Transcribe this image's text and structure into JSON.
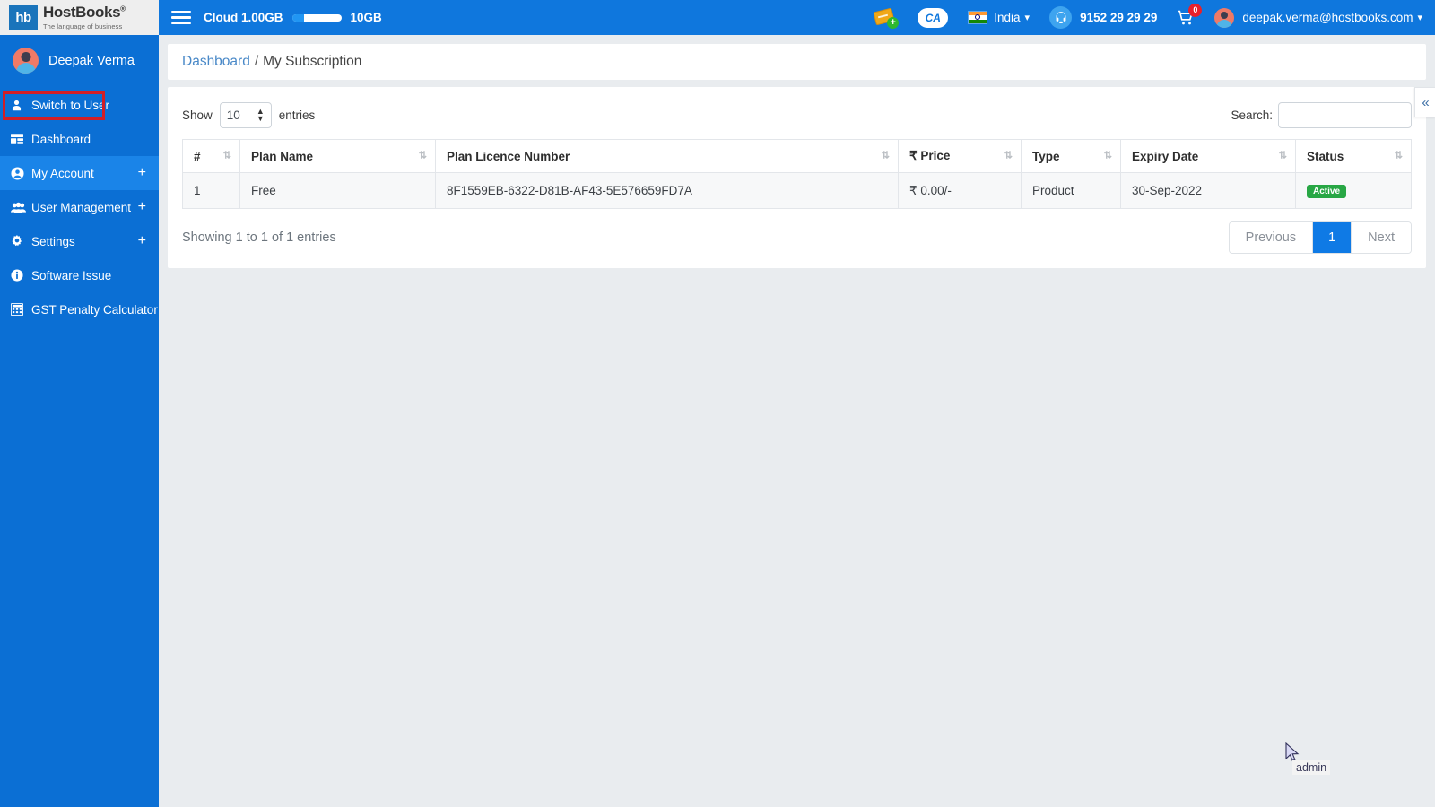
{
  "brand": {
    "logo_mark": "hb",
    "logo_title": "HostBooks",
    "logo_reg": "®",
    "logo_tagline": "The language of business"
  },
  "topbar": {
    "menu_icon": "hamburger-icon",
    "cloud_used_label": "Cloud 1.00GB",
    "cloud_total_label": "10GB",
    "cloud_fill_percent": 25,
    "raise_ticket_icon": "ticket-plus-icon",
    "ca_label": "CA",
    "country": "India",
    "country_flag_icon": "india-flag-icon",
    "support_icon": "headset-icon",
    "phone": "9152 29 29 29",
    "cart_icon": "cart-icon",
    "cart_badge": "0",
    "user_email": "deepak.verma@hostbooks.com",
    "caret_glyph": "⌄"
  },
  "sidebar": {
    "profile_name": "Deepak Verma",
    "profile_avatar": "user-avatar",
    "items": [
      {
        "label": "Switch to User",
        "icon": "person-icon",
        "has_plus": false,
        "active": false,
        "highlighted": true
      },
      {
        "label": "Dashboard",
        "icon": "dashboard-icon",
        "has_plus": false,
        "active": false,
        "highlighted": false
      },
      {
        "label": "My Account",
        "icon": "account-circle-icon",
        "has_plus": true,
        "active": true,
        "highlighted": false
      },
      {
        "label": "User Management",
        "icon": "users-icon",
        "has_plus": true,
        "active": false,
        "highlighted": false
      },
      {
        "label": "Settings",
        "icon": "gear-icon",
        "has_plus": true,
        "active": false,
        "highlighted": false
      },
      {
        "label": "Software Issue",
        "icon": "info-icon",
        "has_plus": false,
        "active": false,
        "highlighted": false
      },
      {
        "label": "GST Penalty Calculator",
        "icon": "calculator-icon",
        "has_plus": false,
        "active": false,
        "highlighted": false
      }
    ],
    "plus_glyph": "+"
  },
  "breadcrumb": {
    "parent": "Dashboard",
    "separator": "/",
    "current": "My Subscription"
  },
  "table_controls": {
    "show_label": "Show",
    "entries_value": "10",
    "entries_label": "entries",
    "search_label": "Search:",
    "search_value": "",
    "search_placeholder": ""
  },
  "table": {
    "columns": [
      {
        "label": "#",
        "sortable": true
      },
      {
        "label": "Plan Name",
        "sortable": true
      },
      {
        "label": "Plan Licence Number",
        "sortable": true
      },
      {
        "label": "₹ Price",
        "sortable": true
      },
      {
        "label": "Type",
        "sortable": true
      },
      {
        "label": "Expiry Date",
        "sortable": true
      },
      {
        "label": "Status",
        "sortable": true
      }
    ],
    "sort_glyph": "⇅",
    "rows": [
      {
        "index": "1",
        "plan_name": "Free",
        "licence": "8F1559EB-6322-D81B-AF43-5E576659FD7A",
        "price": "₹  0.00/-",
        "type": "Product",
        "expiry": "30-Sep-2022",
        "status": "Active"
      }
    ]
  },
  "footer": {
    "showing_text": "Showing 1 to 1 of 1 entries",
    "previous_label": "Previous",
    "current_page": "1",
    "next_label": "Next"
  },
  "collapse_tab": {
    "glyph": "«",
    "name": "collapse-panel-toggle"
  },
  "overlay": {
    "tooltip_text": "admin"
  },
  "colors": {
    "sidebar_blue": "#0b6fd4",
    "topbar_blue": "#0f77dd",
    "active_item_blue": "#1a84e8",
    "highlight_red": "#d21e26",
    "status_green": "#28a745",
    "page_active_blue": "#0f7ae5",
    "link_blue": "#4a89c8",
    "badge_red": "#e8202a"
  }
}
